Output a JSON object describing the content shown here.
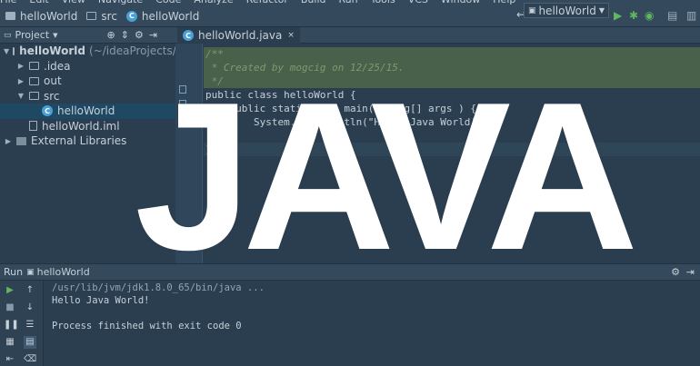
{
  "menu": [
    "File",
    "Edit",
    "View",
    "Navigate",
    "Code",
    "Analyze",
    "Refactor",
    "Build",
    "Run",
    "Tools",
    "VCS",
    "Window",
    "Help"
  ],
  "breadcrumbs": [
    "helloWorld",
    "src",
    "helloWorld"
  ],
  "run_config": "helloWorld",
  "project_panel": {
    "title": "Project",
    "tree": [
      {
        "name": "helloWorld",
        "hint": "(~/ideaProjects/hel",
        "level": 0,
        "expanded": true,
        "kind": "project"
      },
      {
        "name": ".idea",
        "level": 1,
        "expanded": false,
        "kind": "folder"
      },
      {
        "name": "out",
        "level": 1,
        "expanded": false,
        "kind": "folder"
      },
      {
        "name": "src",
        "level": 1,
        "expanded": true,
        "kind": "folder"
      },
      {
        "name": "helloWorld",
        "level": 2,
        "kind": "class",
        "selected": true
      },
      {
        "name": "helloWorld.iml",
        "level": 1,
        "kind": "file"
      },
      {
        "name": "External Libraries",
        "level": 0,
        "expanded": false,
        "kind": "lib"
      }
    ]
  },
  "editor": {
    "tab": "helloWorld.java",
    "lines": [
      {
        "text": "/**",
        "style": "comment"
      },
      {
        "text": " * Created by mogcig on 12/25/15.",
        "style": "comment"
      },
      {
        "text": " */",
        "style": "comment"
      },
      {
        "text": "public class helloWorld {",
        "style": "plain"
      },
      {
        "text": "    public static void main(String[] args ) {",
        "style": "plain"
      },
      {
        "text": "        System.out.println(\"Hello Java World!\");",
        "style": "plain"
      },
      {
        "text": "    }",
        "style": "plain"
      },
      {
        "text": "}",
        "style": "plain"
      }
    ]
  },
  "overlay_title": "JAVA",
  "run_panel": {
    "title": "Run",
    "config": "helloWorld",
    "console": [
      "/usr/lib/jvm/jdk1.8.0_65/bin/java ...",
      "Hello Java World!",
      "",
      "Process finished with exit code 0"
    ]
  },
  "colors": {
    "background": "#2b3e50",
    "panel_header": "#34495b",
    "selection": "#1f4863",
    "comment_highlight": "#49604a",
    "overlay_text": "#ffffff"
  }
}
